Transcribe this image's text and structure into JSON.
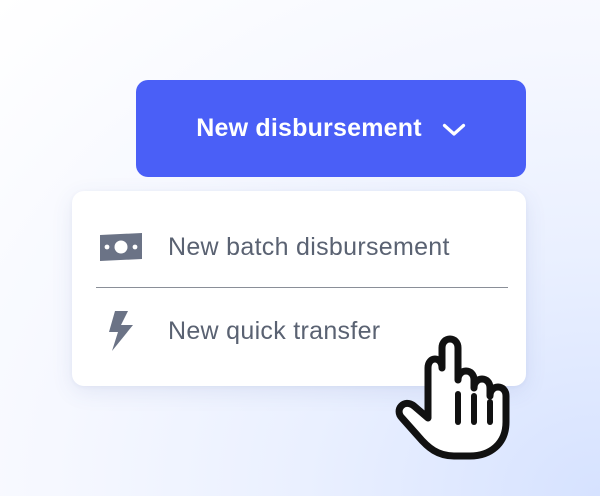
{
  "primary_button": {
    "label": "New disbursement",
    "icon": "chevron-down-icon"
  },
  "menu": {
    "items": [
      {
        "label": "New batch disbursement",
        "icon": "banknote-icon"
      },
      {
        "label": "New quick transfer",
        "icon": "lightning-icon"
      }
    ]
  },
  "cursor": {
    "icon": "hand-pointer-icon"
  },
  "colors": {
    "accent": "#4a5ff7",
    "menu_text": "#5a6272",
    "icon_gray": "#6b7386",
    "background_tint": "#d6e2ff"
  }
}
